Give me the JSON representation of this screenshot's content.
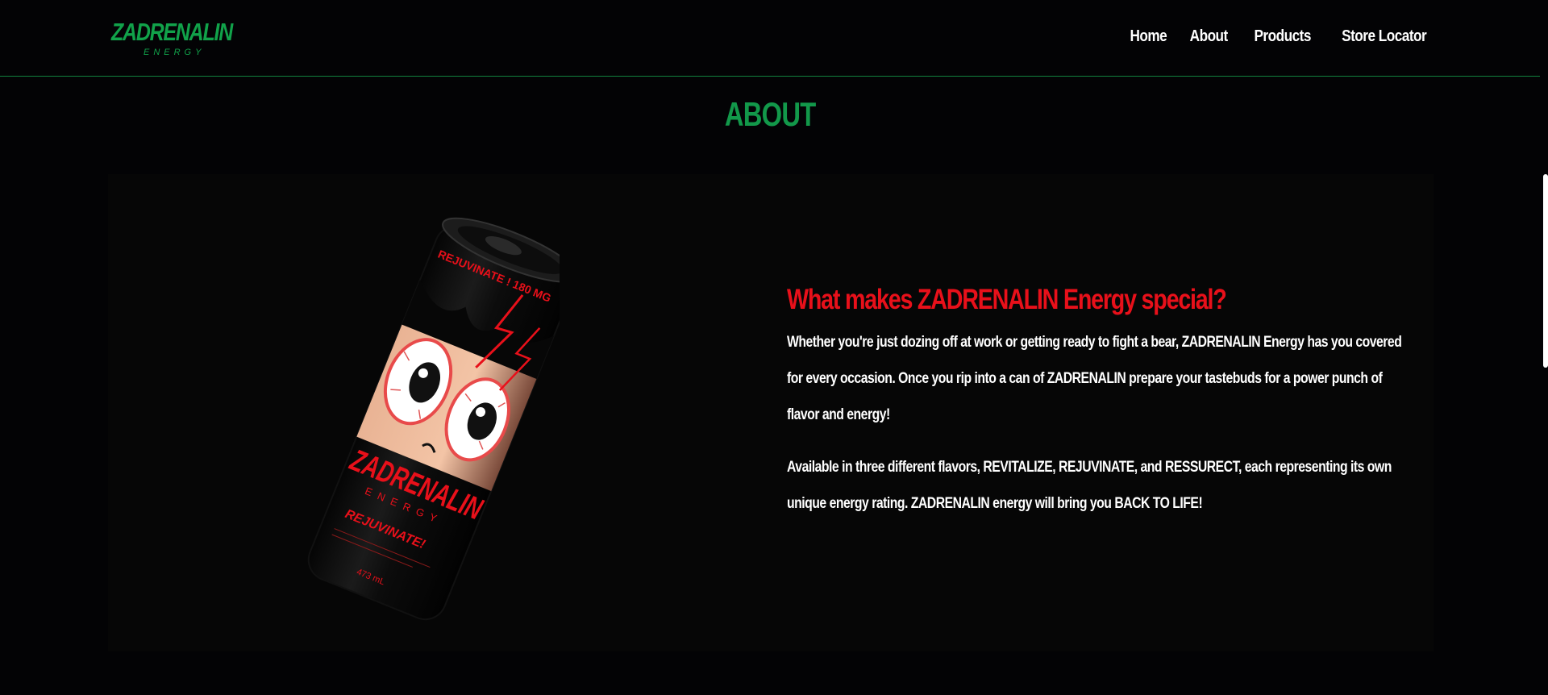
{
  "header": {
    "logo_text": "ZADRENALIN",
    "logo_subtext": "ENERGY",
    "nav": [
      {
        "label": "Home"
      },
      {
        "label": "About"
      },
      {
        "label": "Products"
      },
      {
        "label": "Store Locator"
      }
    ]
  },
  "about": {
    "title": "ABOUT",
    "headline": "What makes ZADRENALIN Energy special?",
    "paragraph_1": "Whether you're just dozing off at work or getting ready to fight a bear, ZADRENALIN Energy has you covered for every occasion. Once you rip into a can of ZADRENALIN prepare your tastebuds for a power punch of flavor and energy!",
    "paragraph_2": "Available in three different flavors, REVITALIZE, REJUVINATE, and RESSURECT, each representing its own unique energy rating. ZADRENALIN energy will bring you BACK TO LIFE!",
    "can": {
      "brand": "ZADRENALIN",
      "sub": "ENERGY",
      "flavor": "REJUVINATE!",
      "band_text": "REJUVINATE ! 180 MG",
      "volume": "473 mL"
    }
  },
  "colors": {
    "background": "#030305",
    "accent_green": "#12984a",
    "headline_red": "#e8101a",
    "text": "#ffffff"
  }
}
